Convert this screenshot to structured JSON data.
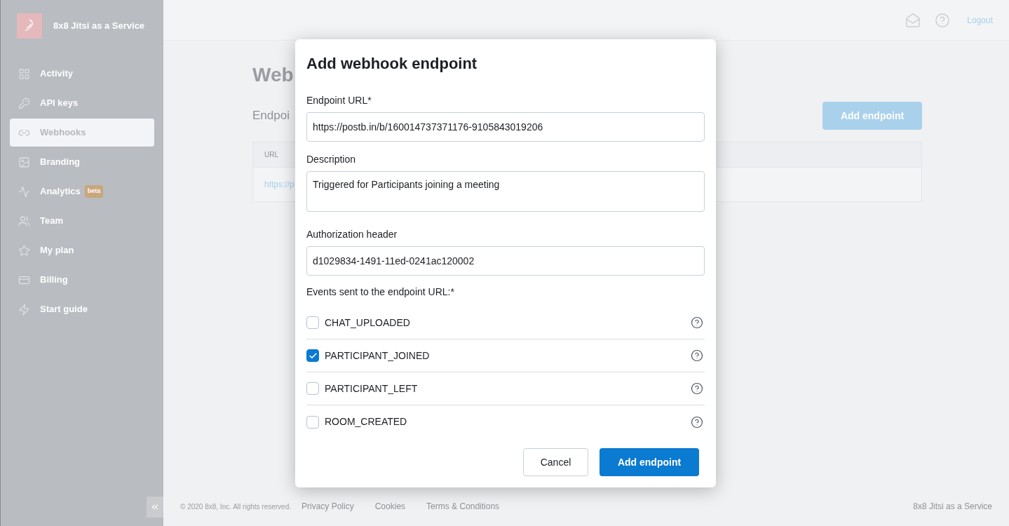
{
  "sidebar": {
    "brand": "8x8 Jitsi as a Service",
    "items": [
      {
        "label": "Activity",
        "selected": false
      },
      {
        "label": "API keys",
        "selected": false
      },
      {
        "label": "Webhooks",
        "selected": true
      },
      {
        "label": "Branding",
        "selected": false
      },
      {
        "label": "Analytics",
        "selected": false,
        "badge": "beta"
      },
      {
        "label": "Team",
        "selected": false
      },
      {
        "label": "My plan",
        "selected": false
      },
      {
        "label": "Billing",
        "selected": false
      },
      {
        "label": "Start guide",
        "selected": false
      }
    ]
  },
  "header": {
    "logout": "Logout"
  },
  "page": {
    "title": "Web",
    "section": "Endpoi",
    "add_button": "Add endpoint",
    "table": {
      "columns": [
        "URL"
      ],
      "rows": [
        [
          "https://p"
        ]
      ]
    }
  },
  "footer": {
    "copyright": "© 2020 8x8, Inc. All rights reserved.",
    "links": [
      "Privacy Policy",
      "Cookies",
      "Terms & Conditions"
    ],
    "brand": "8x8 Jitsi as a Service"
  },
  "dialog": {
    "title": "Add webhook endpoint",
    "fields": [
      {
        "label": "Endpoint URL*",
        "value": "https://postb.in/b/160014737371176-9105843019206",
        "kind": "input"
      },
      {
        "label": "Description",
        "value": "Triggered for Participants joining a meeting",
        "kind": "textarea"
      },
      {
        "label": "Authorization header",
        "value": "d1029834-1491-11ed-0241ac120002",
        "kind": "input"
      }
    ],
    "events_label": "Events sent to the endpoint URL:*",
    "events": [
      {
        "name": "CHAT_UPLOADED",
        "checked": false
      },
      {
        "name": "PARTICIPANT_JOINED",
        "checked": true
      },
      {
        "name": "PARTICIPANT_LEFT",
        "checked": false
      },
      {
        "name": "ROOM_CREATED",
        "checked": false
      }
    ],
    "buttons": [
      {
        "label": "Cancel",
        "kind": "secondary"
      },
      {
        "label": "Add endpoint",
        "kind": "primary"
      }
    ]
  }
}
